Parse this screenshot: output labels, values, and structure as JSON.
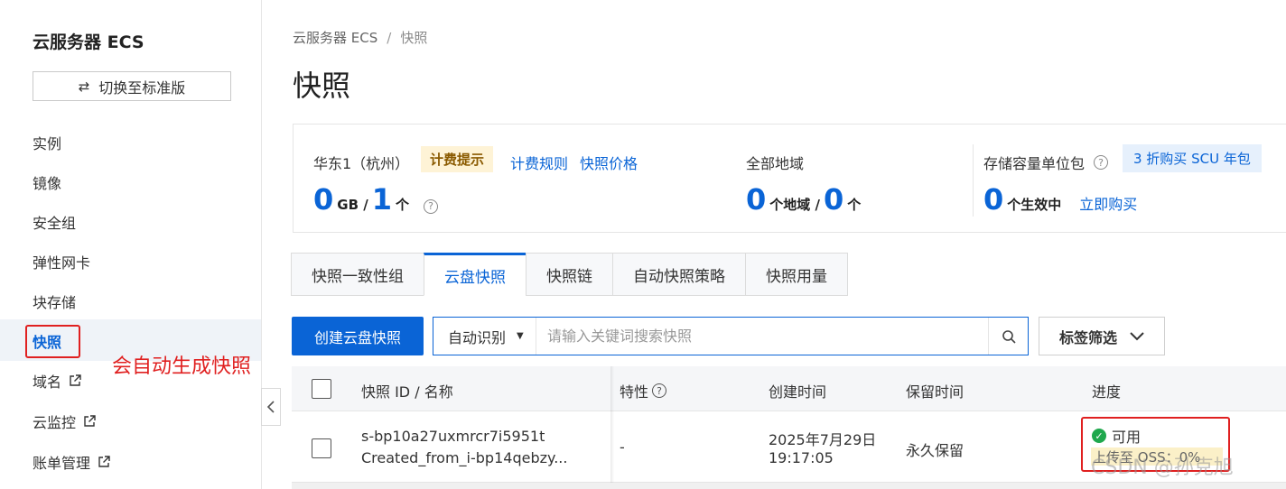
{
  "sidebar": {
    "title": "云服务器 ECS",
    "switch_label": "切换至标准版",
    "items": [
      {
        "label": "实例"
      },
      {
        "label": "镜像"
      },
      {
        "label": "安全组"
      },
      {
        "label": "弹性网卡"
      },
      {
        "label": "块存储"
      },
      {
        "label": "快照"
      },
      {
        "label": "域名"
      },
      {
        "label": "云监控"
      },
      {
        "label": "账单管理"
      }
    ],
    "active_item": "快照",
    "annotation": "会自动生成快照"
  },
  "breadcrumb": {
    "root": "云服务器 ECS",
    "sep": "/",
    "current": "快照"
  },
  "page_title": "快照",
  "summary": {
    "region": {
      "label": "华东1（杭州）",
      "tip_badge": "计费提示",
      "link1": "计费规则",
      "link2": "快照价格",
      "num1": "0",
      "unit1": "GB /",
      "num2": "1",
      "unit2": "个"
    },
    "all_regions": {
      "label": "全部地域",
      "num1": "0",
      "unit1": "个地域 /",
      "num2": "0",
      "unit2": "个"
    },
    "scu": {
      "label": "存储容量单位包",
      "badge": "3 折购买 SCU 年包",
      "num": "0",
      "unit": "个生效中",
      "link": "立即购买"
    }
  },
  "tabs": [
    {
      "label": "快照一致性组"
    },
    {
      "label": "云盘快照"
    },
    {
      "label": "快照链"
    },
    {
      "label": "自动快照策略"
    },
    {
      "label": "快照用量"
    }
  ],
  "toolbar": {
    "create_label": "创建云盘快照",
    "search_mode": "自动识别",
    "search_placeholder": "请输入关键词搜索快照",
    "tag_filter_label": "标签筛选"
  },
  "table": {
    "headers": {
      "id_name": "快照 ID / 名称",
      "feature": "特性",
      "created": "创建时间",
      "retention": "保留时间",
      "progress": "进度"
    },
    "rows": [
      {
        "id": "s-bp10a27uxmrcr7i5951t",
        "name": "Created_from_i-bp14qebzy...",
        "feature": "-",
        "created_date": "2025年7月29日",
        "created_time": "19:17:05",
        "retention": "永久保留",
        "status": "可用",
        "upload": "上传至 OSS：0%"
      }
    ]
  },
  "watermark": "CSDN @孙克旭",
  "colors": {
    "accent": "#0a64d6",
    "annotation_red": "#e02020",
    "ok_green": "#1fa84d"
  }
}
